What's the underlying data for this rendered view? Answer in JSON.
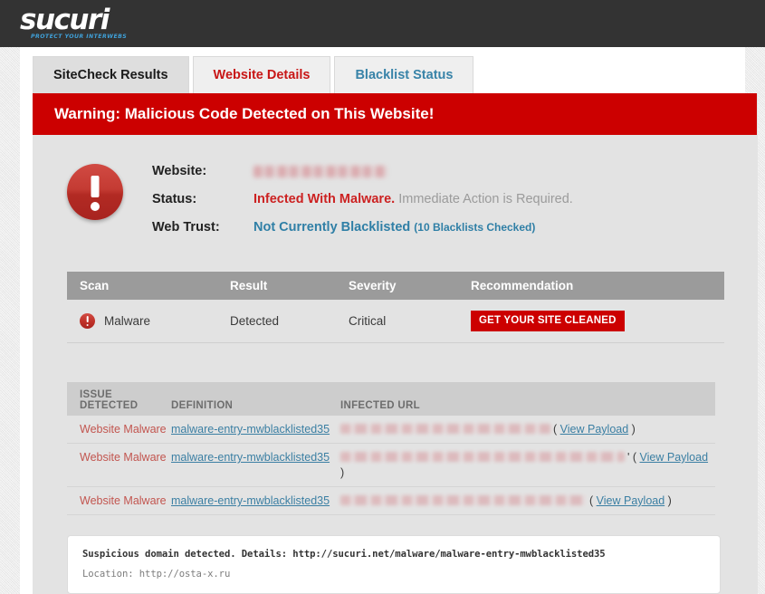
{
  "brand": {
    "logo_word": "sucuri",
    "logo_tagline": "PROTECT YOUR INTERWEBS",
    "accent_red": "#cc0000",
    "accent_blue": "#3fa0d8",
    "header_bg": "#333333"
  },
  "tabs": [
    {
      "label": "SiteCheck Results",
      "state": "active"
    },
    {
      "label": "Website Details",
      "state": "red"
    },
    {
      "label": "Blacklist Status",
      "state": "blue"
    }
  ],
  "banner": {
    "text": "Warning: Malicious Code Detected on This Website!"
  },
  "summary": {
    "website_label": "Website:",
    "website_value": "",
    "status_label": "Status:",
    "status_value": "Infected With Malware.",
    "status_note": "Immediate Action is Required.",
    "webtrust_label": "Web Trust:",
    "webtrust_value": "Not Currently Blacklisted",
    "webtrust_note": "(10 Blacklists Checked)"
  },
  "scan_table": {
    "headers": [
      "Scan",
      "Result",
      "Severity",
      "Recommendation"
    ],
    "rows": [
      {
        "scan": "Malware",
        "result": "Detected",
        "severity": "Critical",
        "recommendation": "GET YOUR SITE CLEANED"
      }
    ]
  },
  "issues_table": {
    "headers": {
      "issue_line1": "ISSUE",
      "issue_line2": "DETECTED",
      "definition": "DEFINITION",
      "infected_url": "INFECTED URL"
    },
    "rows": [
      {
        "issue": "Website Malware",
        "definition": "malware-entry-mwblacklisted35",
        "url_redacted": true,
        "url_width": 232,
        "payload_open": "(",
        "payload_label": "View Payload",
        "payload_close": ")",
        "wraps": false
      },
      {
        "issue": "Website Malware",
        "definition": "malware-entry-mwblacklisted35",
        "url_redacted": true,
        "url_width": 314,
        "payload_open": "' (",
        "payload_label": "View Payload",
        "payload_close": ")",
        "wraps": true
      },
      {
        "issue": "Website Malware",
        "definition": "malware-entry-mwblacklisted35",
        "url_redacted": true,
        "url_width": 272,
        "payload_open": "(",
        "payload_label": "View Payload",
        "payload_close": ")",
        "wraps": false
      }
    ]
  },
  "code_box": {
    "line1": "Suspicious domain detected. Details: http://sucuri.net/malware/malware-entry-mwblacklisted35",
    "line2": "Location: http://osta-x.ru"
  }
}
